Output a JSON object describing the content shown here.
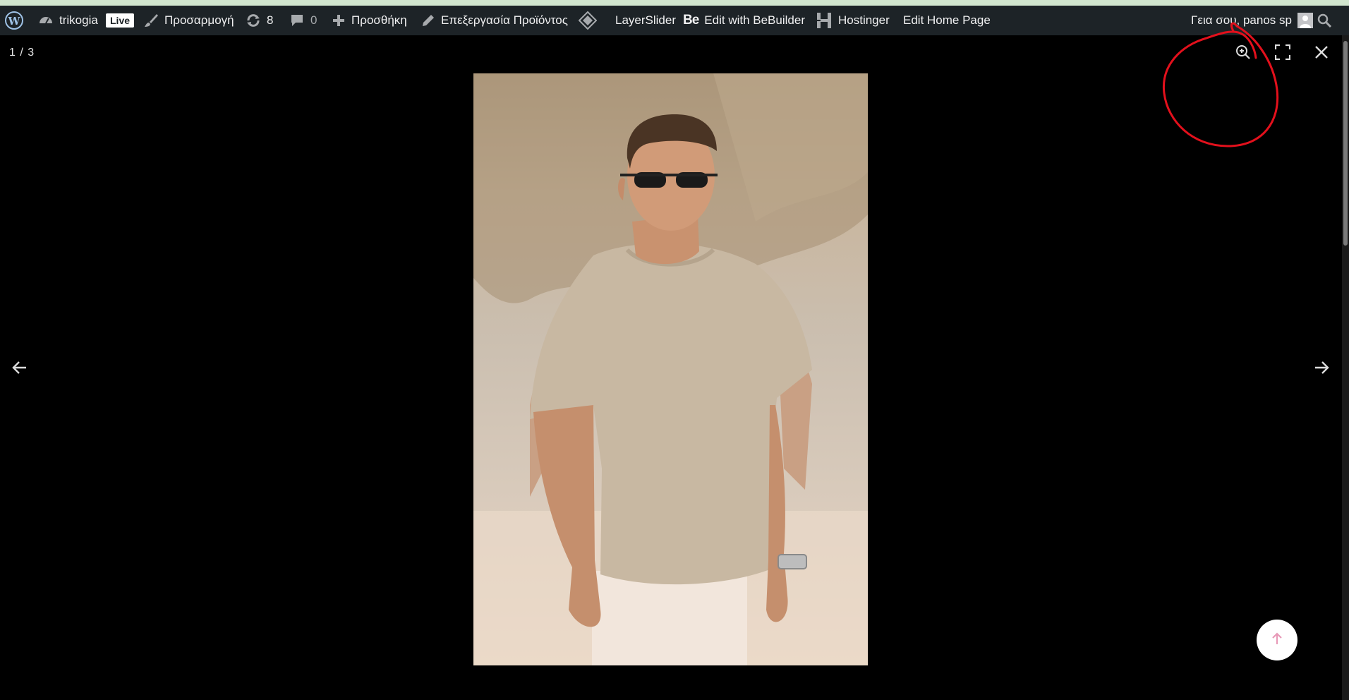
{
  "admin_bar": {
    "site_name": "trikogia",
    "live_badge": "Live",
    "customize": "Προσαρμογή",
    "updates_count": "8",
    "comments_count": "0",
    "add_new": "Προσθήκη",
    "edit_product": "Επεξεργασία Προϊόντος",
    "layerslider": "LayerSlider",
    "bebuilder_mark": "Be",
    "bebuilder": "Edit with BeBuilder",
    "hostinger": "Hostinger",
    "edit_home": "Edit Home Page",
    "greeting": "Γεια σου, panos sp"
  },
  "lightbox": {
    "counter": "1 / 3",
    "image_description": "Man wearing sunglasses, a beige t-shirt and light trousers in a sandy outdoor setting"
  },
  "colors": {
    "admin_bar_bg": "#1d2327",
    "top_strip": "#d2e6cf",
    "overlay_bg": "#000000",
    "annotation": "#e3101c",
    "back_to_top_arrow": "#e89ab8"
  },
  "icons": {
    "wordpress": "wordpress-logo-icon",
    "dashboard": "dashboard-icon",
    "customize": "paintbrush-icon",
    "updates": "updates-icon",
    "comments": "comment-icon",
    "add": "plus-icon",
    "edit": "pencil-icon",
    "layerslider": "layerslider-icon",
    "hostinger": "hostinger-icon",
    "search": "search-icon",
    "zoom": "zoom-in-icon",
    "fullscreen": "fullscreen-icon",
    "close": "close-icon",
    "prev": "arrow-left-icon",
    "next": "arrow-right-icon",
    "back_to_top": "arrow-up-icon"
  }
}
